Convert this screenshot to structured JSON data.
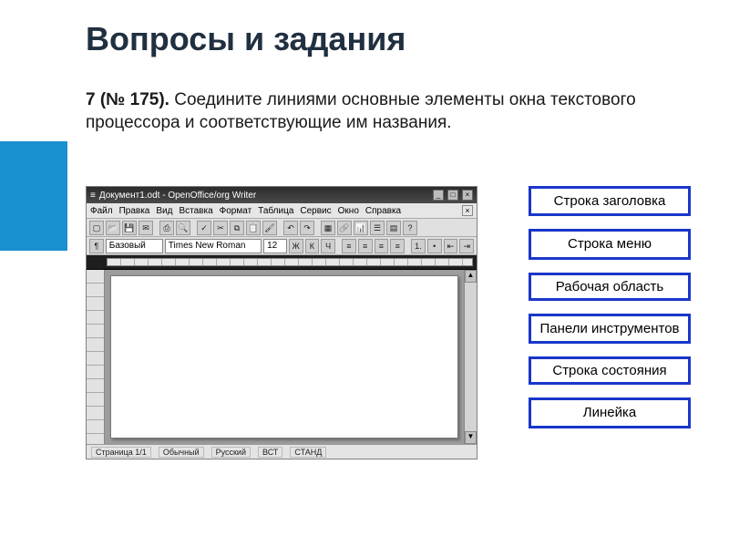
{
  "slide": {
    "title": "Вопросы и задания",
    "task_num": "7 (№ 175).",
    "task_text": "Соедините линиями основные элементы окна текстового процессора и соответствующие им названия."
  },
  "app": {
    "titlebar": {
      "doc_icon": "≡",
      "title": "Документ1.odt - OpenOffice/org Writer",
      "min": "_",
      "max": "□",
      "close": "×"
    },
    "menubar": {
      "items": [
        "Файл",
        "Правка",
        "Вид",
        "Вставка",
        "Формат",
        "Таблица",
        "Сервис",
        "Окно",
        "Справка"
      ],
      "close_doc": "×"
    },
    "toolbar2": {
      "style_combo": "Базовый",
      "font_combo": "Times New Roman",
      "size_combo": "12",
      "bold": "Ж",
      "italic": "К",
      "underline": "Ч"
    },
    "statusbar": {
      "page": "Страница 1/1",
      "style": "Обычный",
      "lang": "Русский",
      "ins": "ВСТ",
      "mode": "СТАНД"
    }
  },
  "labels": {
    "l0": "Строка заголовка",
    "l1": "Строка меню",
    "l2": "Рабочая область",
    "l3": "Панели инструментов",
    "l4": "Строка состояния",
    "l5": "Линейка"
  }
}
